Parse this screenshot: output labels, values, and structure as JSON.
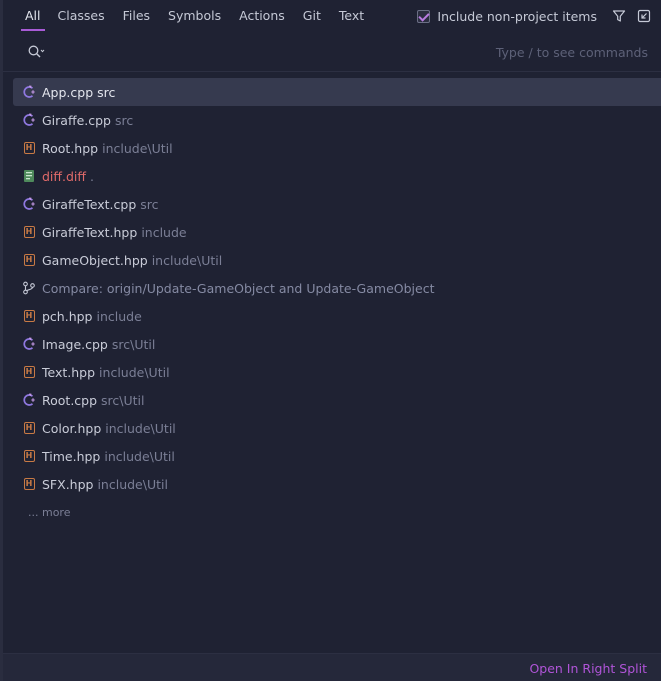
{
  "tabs": [
    {
      "label": "All",
      "active": true
    },
    {
      "label": "Classes"
    },
    {
      "label": "Files"
    },
    {
      "label": "Symbols"
    },
    {
      "label": "Actions"
    },
    {
      "label": "Git"
    },
    {
      "label": "Text"
    }
  ],
  "options": {
    "include_non_project": {
      "label": "Include non-project items",
      "checked": true
    },
    "filter_icon": "filter-icon",
    "preview_icon": "preview-toggle-icon"
  },
  "search": {
    "value": "",
    "placeholder": "",
    "hint": "Type / to see commands"
  },
  "results": [
    {
      "icon": "cpp-file-icon",
      "name": "App.cpp",
      "path": "src",
      "selected": true
    },
    {
      "icon": "cpp-file-icon",
      "name": "Giraffe.cpp",
      "path": "src"
    },
    {
      "icon": "hpp-file-icon",
      "name": "Root.hpp",
      "path": "include\\Util"
    },
    {
      "icon": "diff-file-icon",
      "name": "diff.diff",
      "path": ".",
      "modified": true
    },
    {
      "icon": "cpp-file-icon",
      "name": "GiraffeText.cpp",
      "path": "src"
    },
    {
      "icon": "hpp-file-icon",
      "name": "GiraffeText.hpp",
      "path": "include"
    },
    {
      "icon": "hpp-file-icon",
      "name": "GameObject.hpp",
      "path": "include\\Util"
    },
    {
      "icon": "git-compare-icon",
      "name": "Compare: origin/Update-GameObject and Update-GameObject",
      "path": "",
      "git": true
    },
    {
      "icon": "hpp-file-icon",
      "name": "pch.hpp",
      "path": "include"
    },
    {
      "icon": "cpp-file-icon",
      "name": "Image.cpp",
      "path": "src\\Util"
    },
    {
      "icon": "hpp-file-icon",
      "name": "Text.hpp",
      "path": "include\\Util"
    },
    {
      "icon": "cpp-file-icon",
      "name": "Root.cpp",
      "path": "src\\Util"
    },
    {
      "icon": "hpp-file-icon",
      "name": "Color.hpp",
      "path": "include\\Util"
    },
    {
      "icon": "hpp-file-icon",
      "name": "Time.hpp",
      "path": "include\\Util"
    },
    {
      "icon": "hpp-file-icon",
      "name": "SFX.hpp",
      "path": "include\\Util"
    }
  ],
  "more_label": "... more",
  "footer": {
    "open_split_label": "Open In Right Split"
  },
  "colors": {
    "background": "#1f2233",
    "accent": "#a85bd6",
    "link": "#b054d8",
    "hpp_icon": "#c87a45",
    "cpp_icon": "#8f78e0",
    "modified_text": "#e06a6a"
  }
}
